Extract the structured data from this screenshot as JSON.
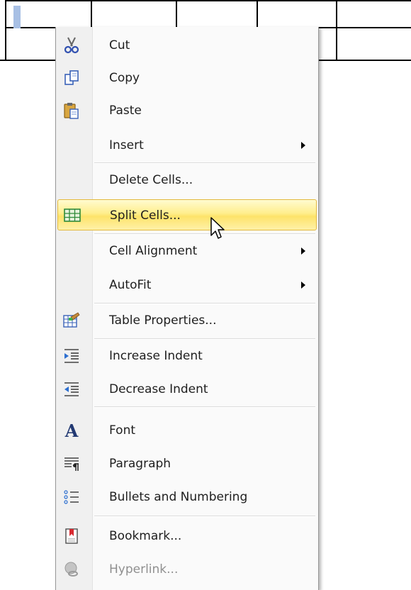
{
  "context_menu": {
    "items": [
      {
        "label": "Cut",
        "icon": "scissors-icon"
      },
      {
        "label": "Copy",
        "icon": "copy-icon"
      },
      {
        "label": "Paste",
        "icon": "paste-icon"
      },
      {
        "label": "Insert",
        "icon": "",
        "submenu": true
      },
      {
        "label": "Delete Cells...",
        "icon": ""
      },
      {
        "label": "Split Cells...",
        "icon": "split-cells-icon",
        "highlighted": true
      },
      {
        "label": "Cell Alignment",
        "icon": "",
        "submenu": true
      },
      {
        "label": "AutoFit",
        "icon": "",
        "submenu": true
      },
      {
        "label": "Table Properties...",
        "icon": "table-properties-icon"
      },
      {
        "label": "Increase Indent",
        "icon": "increase-indent-icon"
      },
      {
        "label": "Decrease Indent",
        "icon": "decrease-indent-icon"
      },
      {
        "label": "Font",
        "icon": "font-icon",
        "icon_glyph": "A"
      },
      {
        "label": "Paragraph",
        "icon": "paragraph-icon"
      },
      {
        "label": "Bullets and Numbering",
        "icon": "bullets-numbering-icon"
      },
      {
        "label": "Bookmark...",
        "icon": "bookmark-icon"
      },
      {
        "label": "Hyperlink...",
        "icon": "hyperlink-icon",
        "disabled": true
      }
    ]
  },
  "colors": {
    "highlight_top": "#fffbd0",
    "highlight_bottom": "#fde36a",
    "highlight_border": "#e3b93f",
    "gutter": "#f0f0f0",
    "disabled_text": "#8f8f8f"
  }
}
